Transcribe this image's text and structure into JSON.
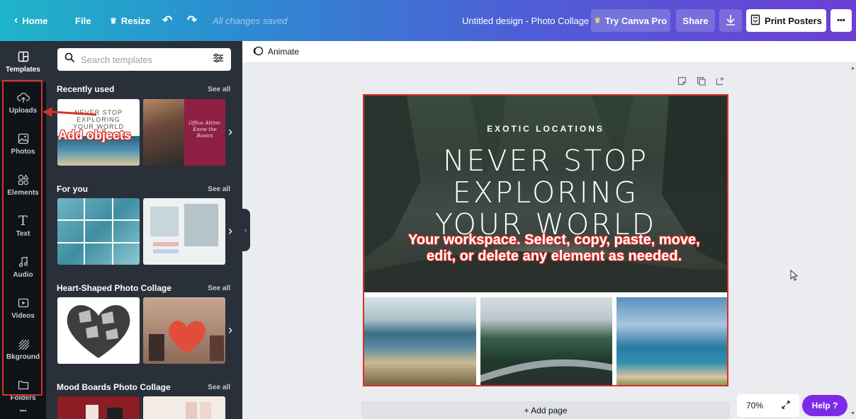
{
  "topbar": {
    "home_label": "Home",
    "file_label": "File",
    "resize_label": "Resize",
    "saved_status": "All changes saved",
    "doc_title": "Untitled design - Photo Collage",
    "try_pro_label": "Try Canva Pro",
    "share_label": "Share",
    "print_label": "Print Posters",
    "more_label": "•••"
  },
  "leftnav": {
    "items": [
      {
        "label": "Templates",
        "icon": "layout-icon"
      },
      {
        "label": "Uploads",
        "icon": "upload-cloud-icon"
      },
      {
        "label": "Photos",
        "icon": "image-icon"
      },
      {
        "label": "Elements",
        "icon": "shapes-icon"
      },
      {
        "label": "Text",
        "icon": "text-T-icon"
      },
      {
        "label": "Audio",
        "icon": "music-note-icon"
      },
      {
        "label": "Videos",
        "icon": "video-icon"
      },
      {
        "label": "Bkground",
        "icon": "pattern-icon"
      },
      {
        "label": "Folders",
        "icon": "folder-icon"
      }
    ],
    "more_label": "•••"
  },
  "panel": {
    "search_placeholder": "Search templates",
    "see_all": "See all",
    "sections": [
      {
        "title": "Recently used"
      },
      {
        "title": "For you"
      },
      {
        "title": "Heart-Shaped Photo Collage"
      },
      {
        "title": "Mood Boards Photo Collage"
      }
    ],
    "thumb_texts": {
      "recent_1": "NEVER STOP\nEXPLORING\nYOUR WORLD",
      "recent_2": "Office Attire:\nKnow the\nBasics"
    }
  },
  "annotations": {
    "add_objects": "Add objects",
    "workspace_line1": "Your workspace. Select, copy, paste, move,",
    "workspace_line2": "edit, or delete any element as needed."
  },
  "animate_label": "Animate",
  "canvas": {
    "subtitle": "EXOTIC LOCATIONS",
    "title": "NEVER STOP\nEXPLORING\nYOUR WORLD"
  },
  "add_page_label": "+ Add page",
  "zoom_level": "70%",
  "help_label": "Help ?",
  "colors": {
    "accent_purple": "#7d2ae8",
    "annotation_red": "#d8322b",
    "panel_dark": "#293039",
    "nav_dark": "#0e1318"
  }
}
